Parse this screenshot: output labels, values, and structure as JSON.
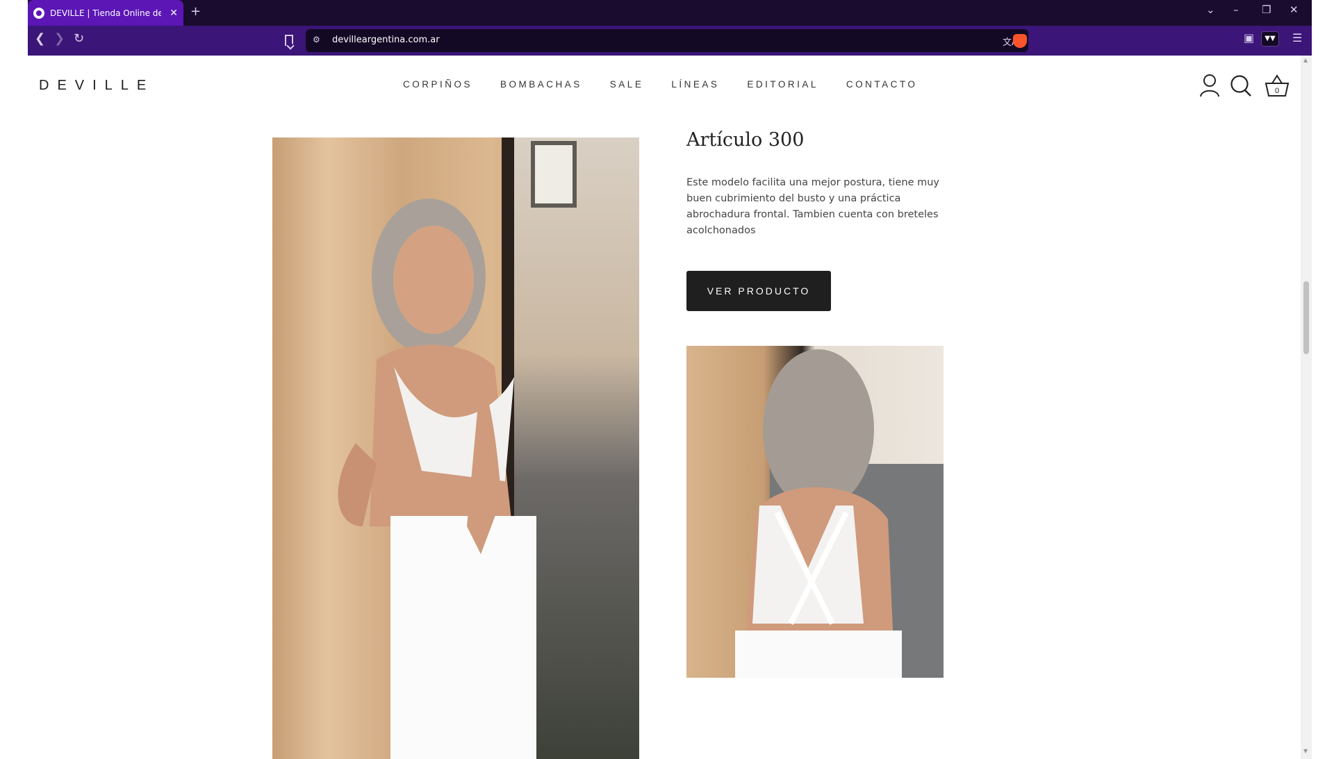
{
  "browser": {
    "tab_title": "DEVILLE | Tienda Online de Ropa",
    "tab_close": "✕",
    "new_tab": "+",
    "url": "devilleargentina.com.ar",
    "window_controls": {
      "tab_search": "⌄",
      "minimize": "–",
      "restore": "❐",
      "close": "✕"
    },
    "icons": [
      "favicon",
      "back-arrow-icon",
      "forward-arrow-icon",
      "reload-icon",
      "bookmark-icon",
      "site-settings-icon",
      "translate-icon",
      "brave-shield-icon",
      "sidebar-icon",
      "wallet-icon",
      "menu-icon"
    ],
    "accent_color": "#5b16b5"
  },
  "site": {
    "logo": "DEVILLE",
    "nav": [
      "CORPIÑOS",
      "BOMBACHAS",
      "SALE",
      "LÍNEAS",
      "EDITORIAL",
      "CONTACTO"
    ],
    "cart_count": "0",
    "header_icons": [
      "account-icon",
      "search-icon",
      "cart-icon"
    ]
  },
  "product": {
    "title": "Artículo 300",
    "description": "Este modelo facilita una mejor postura, tiene muy buen cubrimiento del busto y una práctica abrochadura frontal. Tambien cuenta con breteles acolchonados",
    "cta_label": "VER PRODUCTO"
  }
}
